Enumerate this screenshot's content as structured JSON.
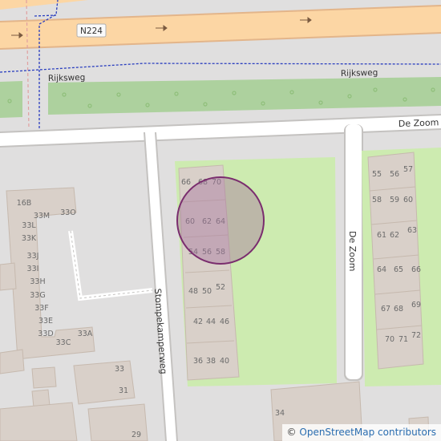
{
  "map": {
    "colors": {
      "background": "#e0dfdf",
      "building": "#d9d0c9",
      "building_stroke": "#c6b9ae",
      "grass": "#cdebb0",
      "green_strip": "#add19e",
      "primary_road": "#fcd6a4",
      "primary_road_casing": "#e3b58a",
      "minor_road": "#ffffff",
      "minor_road_casing": "#c4c2c0",
      "boundary": "#2b3fbf",
      "rail": "#e0a0a0",
      "marker_fill": "#a8789f",
      "marker_stroke": "#7a2d6e"
    },
    "roads": {
      "primary_ref": "N224",
      "rijksweg_west": "Rijksweg",
      "rijksweg_east": "Rijksweg",
      "de_zoom_horizontal": "De Zoom",
      "de_zoom_vertical": "De Zoom",
      "stompekamperweg": "Stompekamperweg"
    },
    "house_numbers": {
      "row1": [
        "66",
        "68",
        "70"
      ],
      "row2": [
        "60",
        "62",
        "64"
      ],
      "row3": [
        "54",
        "56",
        "58"
      ],
      "row4": [
        "48",
        "50",
        "52"
      ],
      "row5": [
        "42",
        "44",
        "46"
      ],
      "row6": [
        "36",
        "38",
        "40"
      ],
      "east": [
        "55",
        "56",
        "57",
        "58",
        "59",
        "60",
        "61",
        "62",
        "63",
        "64",
        "65",
        "66",
        "67",
        "68",
        "69",
        "70",
        "71",
        "72"
      ],
      "west": [
        "16B",
        "33M",
        "33O",
        "33L",
        "33K",
        "33J",
        "33I",
        "33H",
        "33G",
        "33F",
        "33E",
        "33D",
        "33A",
        "33C",
        "33",
        "31",
        "29",
        "34"
      ]
    }
  },
  "attribution": {
    "copyright": "©",
    "link_text": "OpenStreetMap contributors"
  }
}
